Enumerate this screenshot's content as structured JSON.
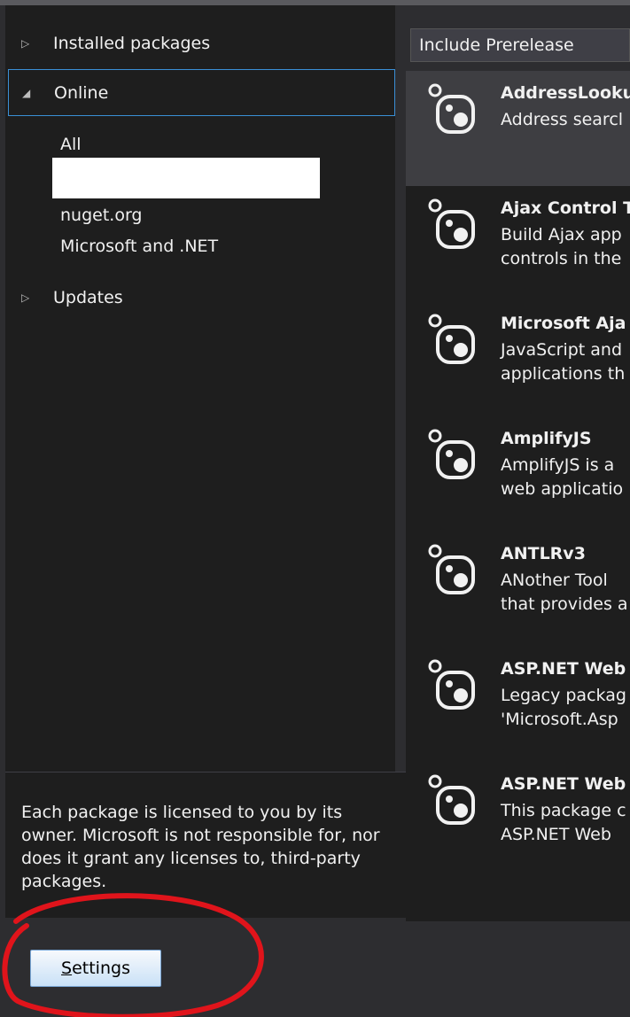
{
  "nav": {
    "installed_label": "Installed packages",
    "online_label": "Online",
    "updates_label": "Updates",
    "online_items": [
      "All",
      "nuget.org",
      "Microsoft and .NET"
    ]
  },
  "filter": {
    "value": "Include Prerelease"
  },
  "packages": [
    {
      "title": "AddressLooku",
      "desc": "Address searcl",
      "icon": "nuget-package-icon",
      "selected": true
    },
    {
      "title": "Ajax Control T",
      "desc": "Build Ajax app\ncontrols in the",
      "icon": "nuget-package-icon"
    },
    {
      "title": "Microsoft Aja",
      "desc": "JavaScript and\napplications th",
      "icon": "nuget-package-icon"
    },
    {
      "title": "AmplifyJS",
      "desc": "AmplifyJS is a\nweb applicatio",
      "icon": "nuget-package-icon"
    },
    {
      "title": "ANTLRv3",
      "desc": "ANother Tool\nthat provides a",
      "icon": "nuget-package-icon"
    },
    {
      "title": "ASP.NET Web",
      "desc": "Legacy packag\n'Microsoft.Asp",
      "icon": "nuget-package-icon"
    },
    {
      "title": "ASP.NET Web",
      "desc": "This package c\nASP.NET Web",
      "icon": "nuget-package-icon"
    }
  ],
  "license_text": "Each package is licensed to you by its owner. Microsoft is not responsible for, nor does it grant any licenses to, third-party packages.",
  "settings_button": {
    "accelerator": "S",
    "rest": "ettings"
  },
  "colors": {
    "accent": "#3a8fd6",
    "annotation": "#e0141b",
    "background": "#2d2d30",
    "pane": "#1e1e1e"
  }
}
